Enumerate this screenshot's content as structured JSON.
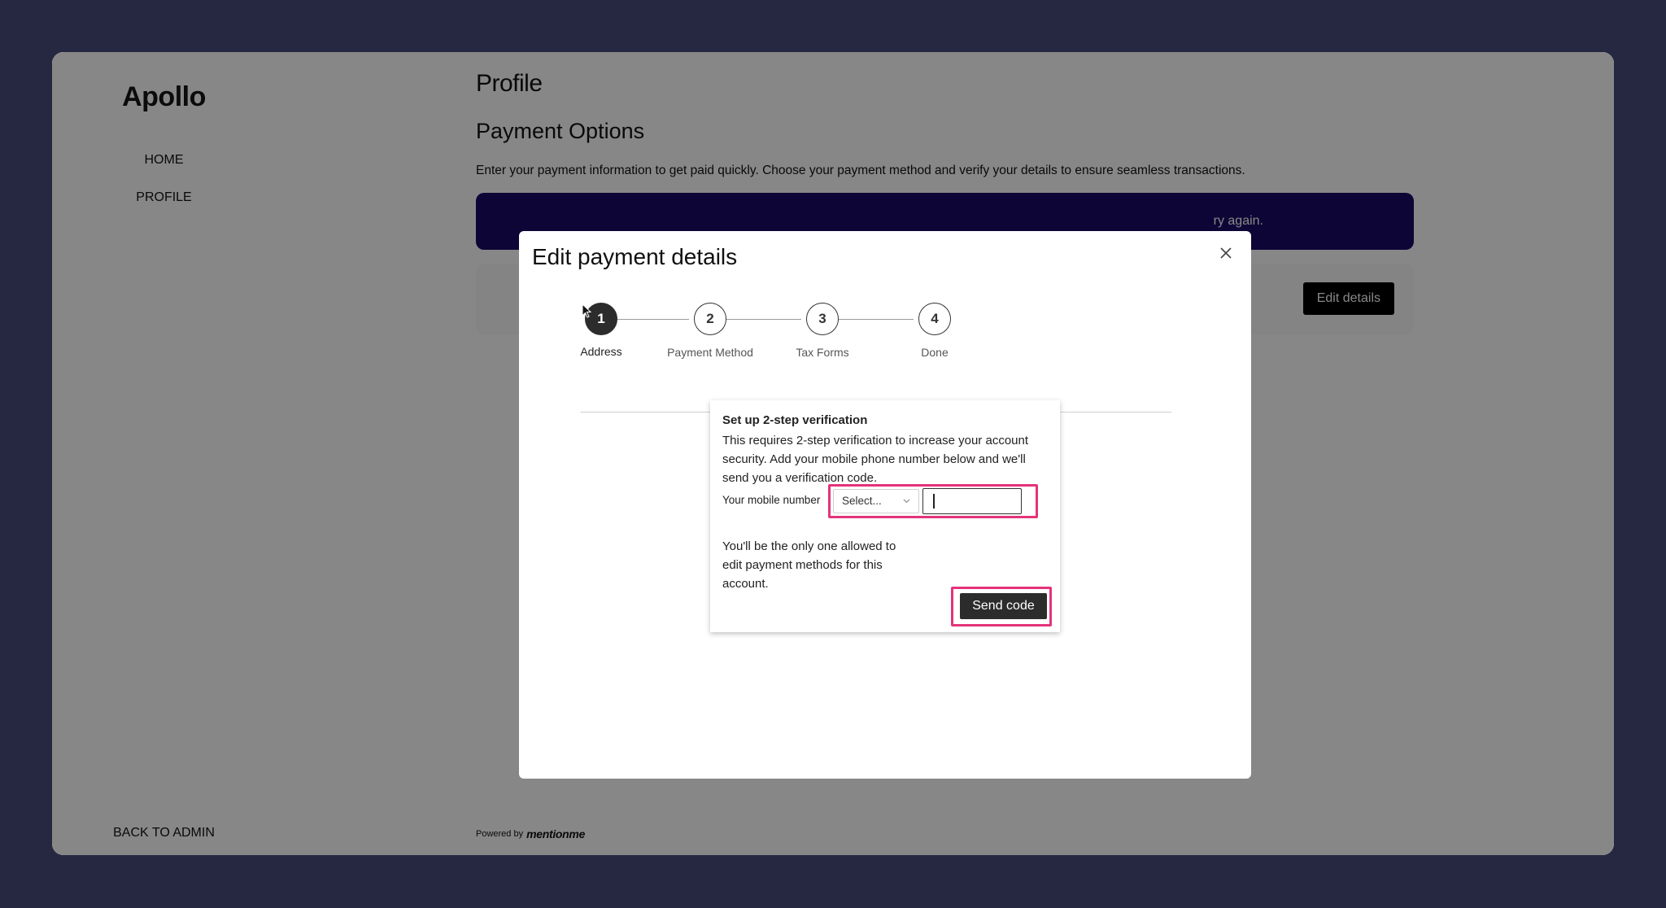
{
  "sidebar": {
    "brand": "Apollo",
    "items": [
      {
        "label": "HOME"
      },
      {
        "label": "PROFILE"
      }
    ],
    "back_label": "BACK TO ADMIN"
  },
  "main": {
    "page_title": "Profile",
    "section_title": "Payment Options",
    "section_desc": "Enter your payment information to get paid quickly. Choose your payment method and verify your details to ensure seamless transactions.",
    "banner_text": "ry again.",
    "edit_details_label": "Edit details",
    "powered_by": "Powered by",
    "powered_brand": "mentionme"
  },
  "modal": {
    "title": "Edit payment details",
    "close_icon": "close-icon",
    "steps": [
      {
        "number": "1",
        "label": "Address",
        "active": true
      },
      {
        "number": "2",
        "label": "Payment Method",
        "active": false
      },
      {
        "number": "3",
        "label": "Tax Forms",
        "active": false
      },
      {
        "number": "4",
        "label": "Done",
        "active": false
      }
    ]
  },
  "verification": {
    "title": "Set up 2-step verification",
    "description": "This requires 2-step verification to increase your account security. Add your mobile phone number below and we'll send you a verification code.",
    "mobile_label": "Your mobile number",
    "country_select_value": "Select...",
    "phone_value": "",
    "note": "You'll be the only one allowed to edit payment methods for this account.",
    "send_label": "Send code"
  },
  "colors": {
    "background": "#262842",
    "banner": "#1a0a66",
    "highlight": "#e5337a",
    "step_active": "#2c2c2c"
  }
}
